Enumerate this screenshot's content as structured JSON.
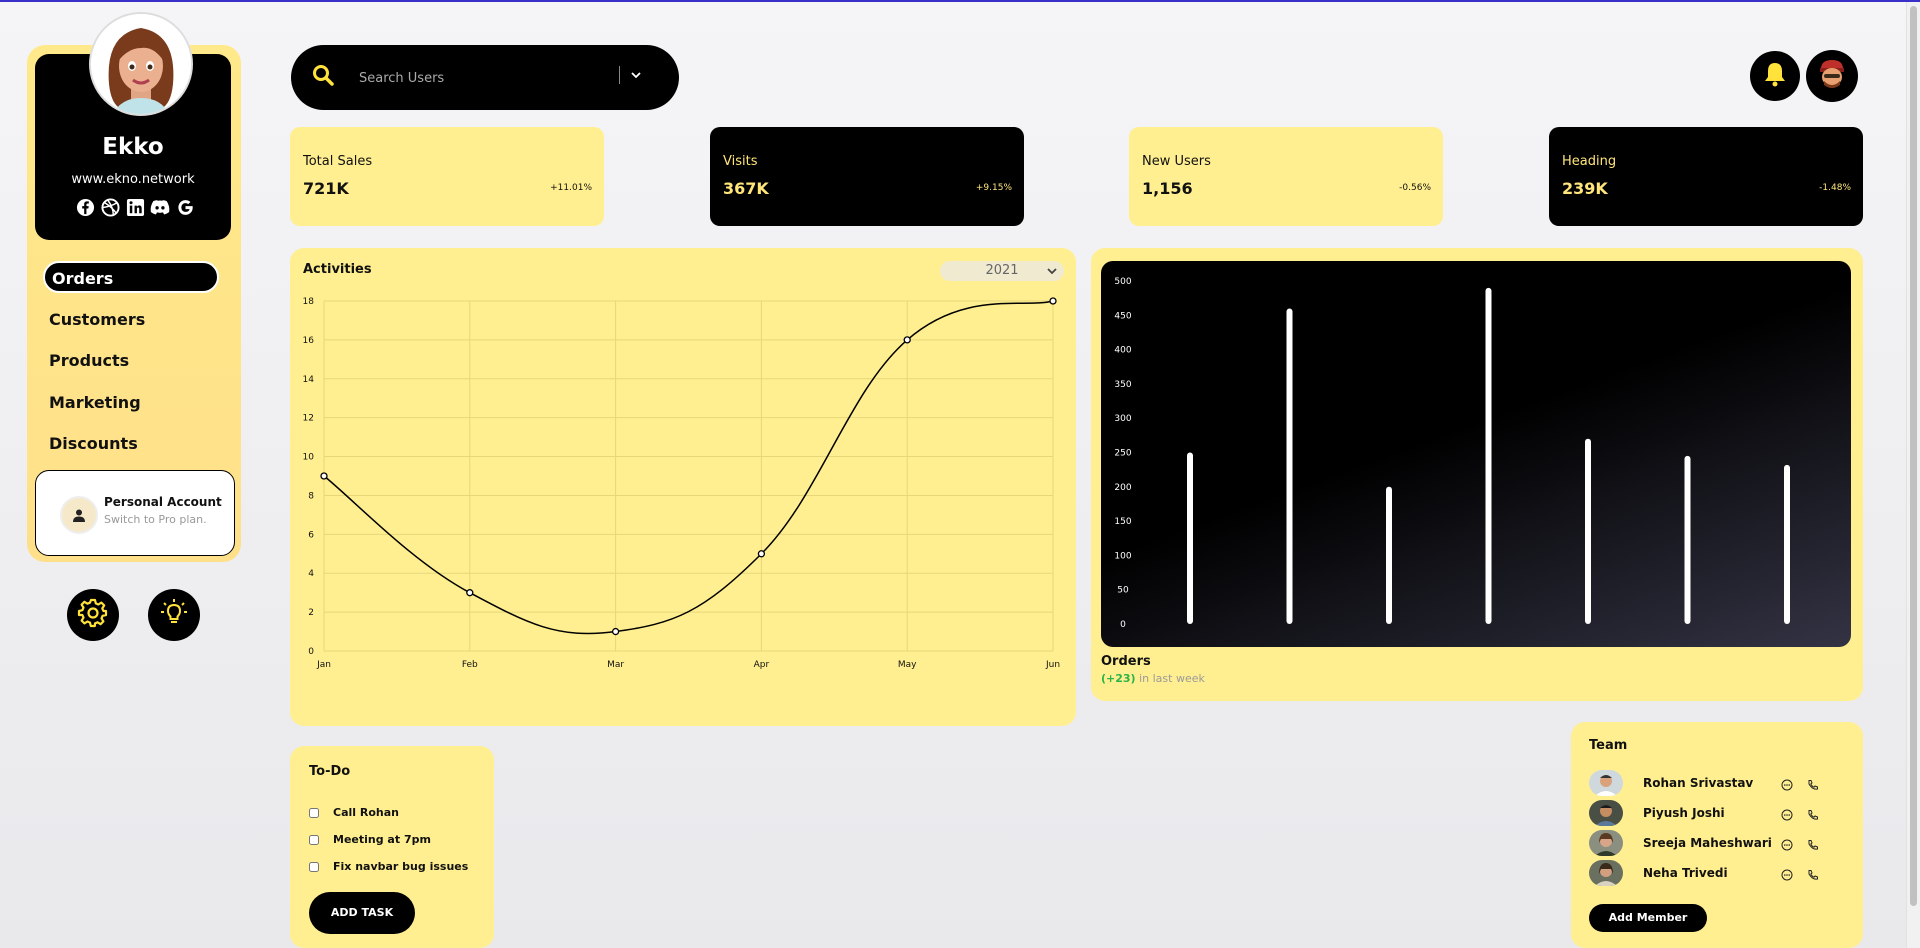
{
  "profile": {
    "name": "Ekko",
    "website": "www.ekno.network",
    "socials": [
      "facebook-icon",
      "dribbble-icon",
      "linkedin-icon",
      "discord-icon",
      "google-icon"
    ]
  },
  "sidebar": {
    "items": [
      {
        "label": "Orders",
        "active": true
      },
      {
        "label": "Customers",
        "active": false
      },
      {
        "label": "Products",
        "active": false
      },
      {
        "label": "Marketing",
        "active": false
      },
      {
        "label": "Discounts",
        "active": false
      }
    ],
    "account": {
      "title": "Personal Account",
      "subtitle": "Switch to Pro plan."
    }
  },
  "search": {
    "placeholder": "Search Users"
  },
  "stats": [
    {
      "label": "Total Sales",
      "value": "721K",
      "change": "+11.01%",
      "theme": "yellow"
    },
    {
      "label": "Visits",
      "value": "367K",
      "change": "+9.15%",
      "theme": "black"
    },
    {
      "label": "New Users",
      "value": "1,156",
      "change": "-0.56%",
      "theme": "yellow"
    },
    {
      "label": "Heading",
      "value": "239K",
      "change": "-1.48%",
      "theme": "black"
    }
  ],
  "activities": {
    "title": "Activities",
    "year": "2021"
  },
  "orders": {
    "title": "Orders",
    "change": "(+23)",
    "change_suffix": " in last week"
  },
  "todo": {
    "title": "To-Do",
    "tasks": [
      "Call Rohan",
      "Meeting at 7pm",
      "Fix navbar bug issues"
    ],
    "add_label": "ADD TASK"
  },
  "team": {
    "title": "Team",
    "members": [
      "Rohan Srivastav",
      "Piyush Joshi",
      "Sreeja Maheshwari",
      "Neha Trivedi"
    ],
    "add_label": "Add Member"
  },
  "colors": {
    "accent": "#ffef90",
    "dark": "#000000",
    "positive": "#2cb34a"
  },
  "chart_data": [
    {
      "type": "line",
      "title": "Activities",
      "categories": [
        "Jan",
        "Feb",
        "Mar",
        "Apr",
        "May",
        "Jun"
      ],
      "values": [
        9,
        3,
        1,
        5,
        16,
        18
      ],
      "ylim": [
        0,
        18
      ],
      "yticks": [
        0,
        2,
        4,
        6,
        8,
        10,
        12,
        14,
        16,
        18
      ],
      "grid": true
    },
    {
      "type": "bar",
      "title": "Orders",
      "categories": [
        "",
        "",
        "",
        "",
        "",
        "",
        ""
      ],
      "values": [
        250,
        460,
        200,
        490,
        270,
        245,
        232
      ],
      "ylim": [
        0,
        500
      ],
      "yticks": [
        0,
        50,
        100,
        150,
        200,
        250,
        300,
        350,
        400,
        450,
        500
      ],
      "grid": false
    }
  ]
}
